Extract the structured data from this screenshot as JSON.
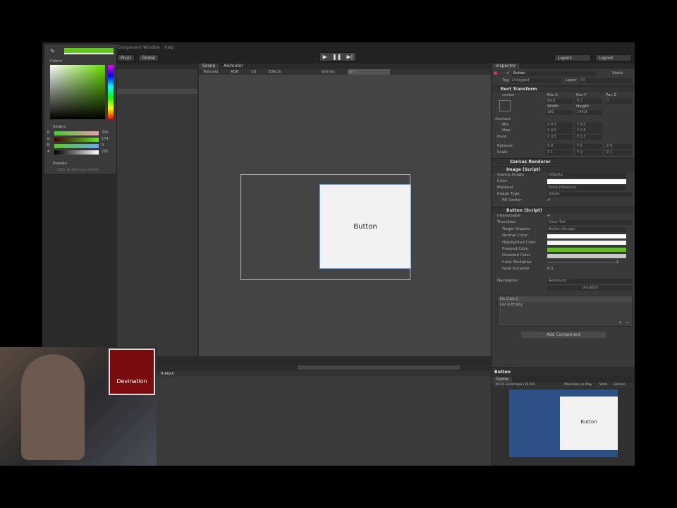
{
  "menu": {
    "items": [
      "Component",
      "Window",
      "Help"
    ]
  },
  "toolbar": {
    "pivot": "Pivot",
    "global": "Global",
    "layers": "Layers",
    "layout": "Layout"
  },
  "scene": {
    "tabs": [
      "Scene",
      "Animator"
    ],
    "shading": "Textured",
    "render_mode": "RGB",
    "mode_2d": "2D",
    "effects": "Effects",
    "gizmos": "Gizmos",
    "search_placeholder": "●All",
    "button_text": "Button"
  },
  "color_picker": {
    "colors_label": "Colors",
    "sliders_label": "Sliders",
    "channels": [
      {
        "label": "R",
        "value": "200"
      },
      {
        "label": "G",
        "value": "174"
      },
      {
        "label": "B",
        "value": "0"
      },
      {
        "label": "A",
        "value": "255"
      }
    ],
    "presets_label": "Presets",
    "add_preset": "Click to add new preset",
    "current_color": "#5fc81a"
  },
  "inspector": {
    "tab": "Inspector",
    "object_name": "Button",
    "static": "Static",
    "tag_label": "Tag",
    "tag": "Untagged",
    "layer_label": "Layer",
    "layer": "UI",
    "rect_transform": {
      "title": "Rect Transform",
      "anchor_preset": "center",
      "pos_x_label": "Pos X",
      "pos_y_label": "Pos Y",
      "pos_z_label": "Pos Z",
      "pos_x": "69.8",
      "pos_y": "0.7",
      "pos_z": "0",
      "width_label": "Width",
      "height_label": "Height",
      "width": "160",
      "height": "149.8",
      "anchors": "Anchors",
      "min": "Min",
      "max": "Max",
      "pivot": "Pivot",
      "rotation": "Rotation",
      "scale": "Scale",
      "min_x": "X 0.5",
      "min_y": "Y 0.5",
      "max_x": "X 0.5",
      "max_y": "Y 0.5",
      "pivot_x": "X 0.5",
      "pivot_y": "Y 0.5",
      "rot_x": "X 0",
      "rot_y": "Y 0",
      "rot_z": "Z 0",
      "scale_x": "X 1",
      "scale_y": "Y 1",
      "scale_z": "Z 1"
    },
    "canvas_renderer": "Canvas Renderer",
    "image": {
      "title": "Image (Script)",
      "source_image_label": "Source Image",
      "source_image": "UISprite",
      "color_label": "Color",
      "material_label": "Material",
      "material": "None (Material)",
      "image_type_label": "Image Type",
      "image_type": "Sliced",
      "fill_center_label": "Fill Center"
    },
    "button": {
      "title": "Button (Script)",
      "interactable_label": "Interactable",
      "transition_label": "Transition",
      "transition": "Color Tint",
      "target_graphic_label": "Target Graphic",
      "target_graphic": "Button (Image)",
      "normal_label": "Normal Color",
      "highlighted_label": "Highlighted Color",
      "pressed_label": "Pressed Color",
      "disabled_label": "Disabled Color",
      "multiplier_label": "Color Multiplier",
      "multiplier": "1",
      "fade_label": "Fade Duration",
      "fade": "0.1",
      "navigation_label": "Navigation",
      "navigation": "Automatic",
      "visualize": "Visualize",
      "on_click": "On Click ()",
      "list_empty": "List is Empty",
      "add_component": "Add Component"
    },
    "colors": {
      "normal": "#ffffff",
      "highlighted": "#f5f5f5",
      "pressed": "#5ec21a",
      "disabled": "#c8c8c8"
    }
  },
  "footer_label": "Button",
  "game": {
    "tab": "Game",
    "aspect": "16:10 Landscape (16:10)",
    "maximize": "Maximize on Play",
    "stats": "Stats",
    "gizmos": "Gizmos",
    "button_text": "Button"
  },
  "project": {
    "folder": "4.6GUI"
  },
  "webcam": {
    "logo_text": "Devination"
  }
}
